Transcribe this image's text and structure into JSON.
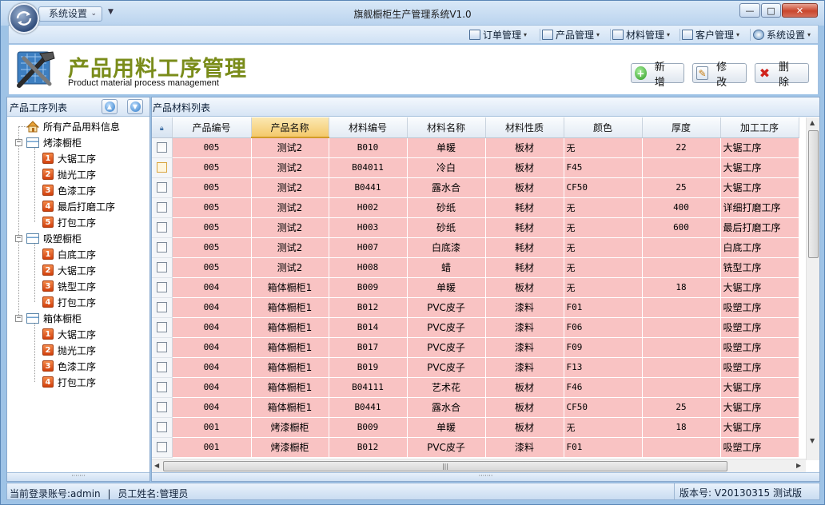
{
  "window": {
    "title": "旗舰橱柜生产管理系统V1.0",
    "system_button": "系统设置",
    "minimize": "—",
    "maximize": "□",
    "close": "✕"
  },
  "menubar": {
    "items": [
      {
        "label": "订单管理"
      },
      {
        "label": "产品管理"
      },
      {
        "label": "材料管理"
      },
      {
        "label": "客户管理"
      },
      {
        "label": "系统设置"
      }
    ]
  },
  "header": {
    "title": "产品用料工序管理",
    "subtitle": "Product material process management",
    "buttons": {
      "add": "新增",
      "edit": "修改",
      "delete": "删除"
    }
  },
  "left_panel": {
    "title": "产品工序列表",
    "tree": {
      "root": "所有产品用料信息",
      "groups": [
        {
          "label": "烤漆橱柜",
          "children": [
            {
              "num": "1",
              "label": "大锯工序"
            },
            {
              "num": "2",
              "label": "抛光工序"
            },
            {
              "num": "3",
              "label": "色漆工序"
            },
            {
              "num": "4",
              "label": "最后打磨工序"
            },
            {
              "num": "5",
              "label": "打包工序"
            }
          ]
        },
        {
          "label": "吸塑橱柜",
          "children": [
            {
              "num": "1",
              "label": "白底工序"
            },
            {
              "num": "2",
              "label": "大锯工序"
            },
            {
              "num": "3",
              "label": "铣型工序"
            },
            {
              "num": "4",
              "label": "打包工序"
            }
          ]
        },
        {
          "label": "箱体橱柜",
          "children": [
            {
              "num": "1",
              "label": "大锯工序"
            },
            {
              "num": "2",
              "label": "抛光工序"
            },
            {
              "num": "3",
              "label": "色漆工序"
            },
            {
              "num": "4",
              "label": "打包工序"
            }
          ]
        }
      ]
    }
  },
  "right_panel": {
    "title": "产品材料列表",
    "columns": [
      "产品编号",
      "产品名称",
      "材料编号",
      "材料名称",
      "材料性质",
      "颜色",
      "厚度",
      "加工工序"
    ],
    "sorted_column": "产品名称",
    "rows": [
      [
        "005",
        "测试2",
        "B010",
        "单暖",
        "板材",
        "无",
        "22",
        "大锯工序"
      ],
      [
        "005",
        "测试2",
        "B04011",
        "冷白",
        "板材",
        "F45",
        "",
        "大锯工序"
      ],
      [
        "005",
        "测试2",
        "B0441",
        "露水合",
        "板材",
        "CF50",
        "25",
        "大锯工序"
      ],
      [
        "005",
        "测试2",
        "H002",
        "砂纸",
        "耗材",
        "无",
        "400",
        "详细打磨工序"
      ],
      [
        "005",
        "测试2",
        "H003",
        "砂纸",
        "耗材",
        "无",
        "600",
        "最后打磨工序"
      ],
      [
        "005",
        "测试2",
        "H007",
        "白底漆",
        "耗材",
        "无",
        "",
        "白底工序"
      ],
      [
        "005",
        "测试2",
        "H008",
        "蜡",
        "耗材",
        "无",
        "",
        "铣型工序"
      ],
      [
        "004",
        "箱体橱柜1",
        "B009",
        "单暖",
        "板材",
        "无",
        "18",
        "大锯工序"
      ],
      [
        "004",
        "箱体橱柜1",
        "B012",
        "PVC皮子",
        "漆料",
        "F01",
        "",
        "吸塑工序"
      ],
      [
        "004",
        "箱体橱柜1",
        "B014",
        "PVC皮子",
        "漆料",
        "F06",
        "",
        "吸塑工序"
      ],
      [
        "004",
        "箱体橱柜1",
        "B017",
        "PVC皮子",
        "漆料",
        "F09",
        "",
        "吸塑工序"
      ],
      [
        "004",
        "箱体橱柜1",
        "B019",
        "PVC皮子",
        "漆料",
        "F13",
        "",
        "吸塑工序"
      ],
      [
        "004",
        "箱体橱柜1",
        "B04111",
        "艺术花",
        "板材",
        "F46",
        "",
        "大锯工序"
      ],
      [
        "004",
        "箱体橱柜1",
        "B0441",
        "露水合",
        "板材",
        "CF50",
        "25",
        "大锯工序"
      ],
      [
        "001",
        "烤漆橱柜",
        "B009",
        "单暖",
        "板材",
        "无",
        "18",
        "大锯工序"
      ],
      [
        "001",
        "烤漆橱柜",
        "B012",
        "PVC皮子",
        "漆料",
        "F01",
        "",
        "吸塑工序"
      ]
    ]
  },
  "statusbar": {
    "login_label": "当前登录账号:admin",
    "separator": "|",
    "employee_label": "员工姓名:管理员",
    "version": "版本号: V20130315 测试版"
  },
  "colors": {
    "row_bg": "#f9c3c3",
    "sorted_header": "#f4c96b",
    "header_title": "#7a8c1a",
    "frame": "#9ec3e6"
  }
}
